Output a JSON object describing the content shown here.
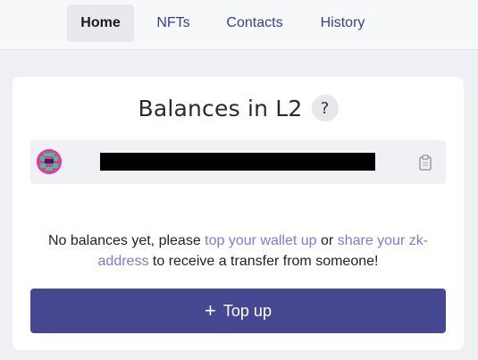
{
  "nav": {
    "tabs": [
      {
        "label": "Home",
        "active": true
      },
      {
        "label": "NFTs",
        "active": false
      },
      {
        "label": "Contacts",
        "active": false
      },
      {
        "label": "History",
        "active": false
      }
    ]
  },
  "balances": {
    "title": "Balances in L2",
    "help_icon": "question-mark-icon",
    "help_label": "?"
  },
  "account": {
    "avatar_icon": "identicon-avatar",
    "address_redacted": true,
    "copy_icon": "clipboard-icon"
  },
  "empty_state": {
    "text_before": "No balances yet, please ",
    "link1": "top your wallet up",
    "text_middle": " or ",
    "link2": "share your zk-address",
    "text_after": " to receive a transfer from someone!"
  },
  "topup": {
    "icon": "plus-icon",
    "plus": "+",
    "label": "Top up"
  },
  "colors": {
    "primary_button": "#454891",
    "link": "#7b7bd6",
    "nav_text": "#3b3f8f",
    "background": "#eef0f4"
  }
}
